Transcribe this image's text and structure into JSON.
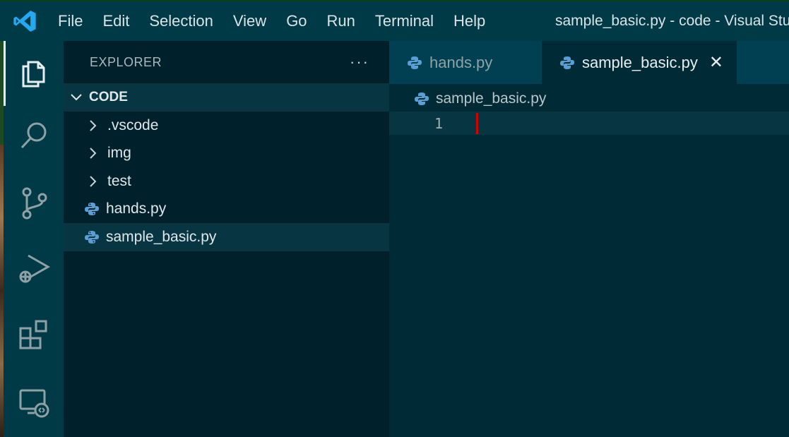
{
  "titlebar": {
    "menu": [
      "File",
      "Edit",
      "Selection",
      "View",
      "Go",
      "Run",
      "Terminal",
      "Help"
    ],
    "window_title": "sample_basic.py - code - Visual Stu"
  },
  "activitybar": {
    "items": [
      "files-icon",
      "search-icon",
      "source-control-icon",
      "run-debug-icon",
      "extensions-icon",
      "remote-explorer-icon"
    ]
  },
  "sidebar": {
    "title": "EXPLORER",
    "more": "···",
    "section": "CODE",
    "items": [
      {
        "label": ".vscode",
        "type": "folder"
      },
      {
        "label": "img",
        "type": "folder"
      },
      {
        "label": "test",
        "type": "folder"
      },
      {
        "label": "hands.py",
        "type": "python"
      },
      {
        "label": "sample_basic.py",
        "type": "python"
      }
    ]
  },
  "editor": {
    "tabs": [
      {
        "label": "hands.py",
        "active": false
      },
      {
        "label": "sample_basic.py",
        "active": true
      }
    ],
    "close_symbol": "✕",
    "breadcrumb": "sample_basic.py",
    "line_number": "1"
  },
  "colors": {
    "python_icon": "#5a9fd4",
    "cursor": "#d30102",
    "vscode_blue": "#23a9f2"
  }
}
